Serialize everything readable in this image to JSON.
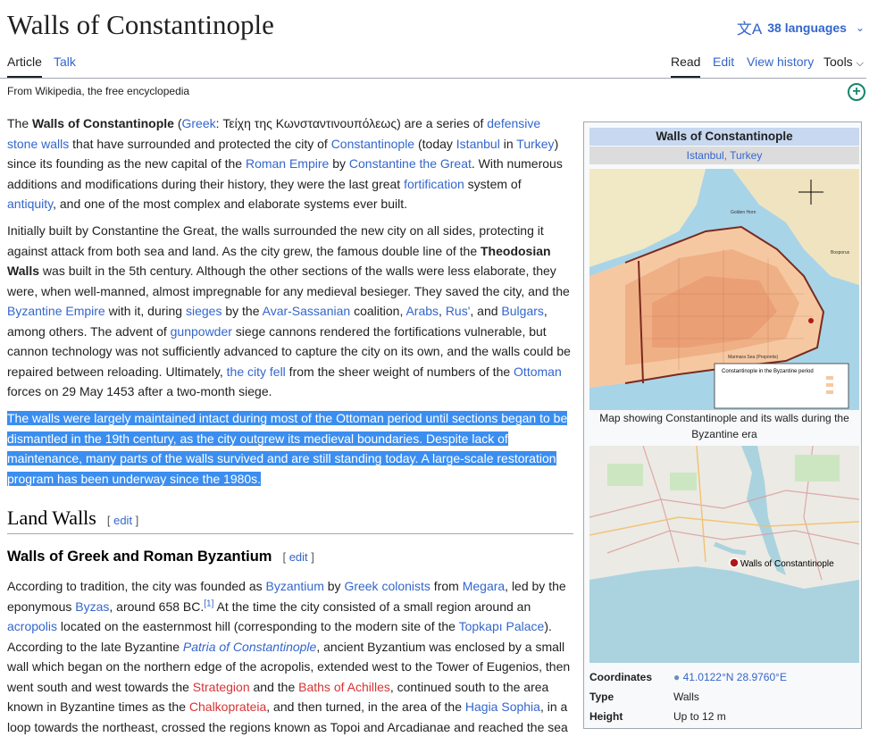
{
  "page": {
    "title": "Walls of Constantinople",
    "languages": "38 languages",
    "tabs": {
      "article": "Article",
      "talk": "Talk",
      "read": "Read",
      "edit": "Edit",
      "history": "View history",
      "tools": "Tools"
    },
    "subtitle": "From Wikipedia, the free encyclopedia"
  },
  "paragraphs": {
    "p1": {
      "t1": "The ",
      "b1": "Walls of Constantinople",
      "t2": " (",
      "l1": "Greek",
      "t3": ": Τείχη της Κωνσταντινουπόλεως) are a series of ",
      "l2": "defensive stone walls",
      "t4": " that have surrounded and protected the city of ",
      "l3": "Constantinople",
      "t5": " (today ",
      "l4": "Istanbul",
      "t6": " in ",
      "l5": "Turkey",
      "t7": ") since its founding as the new capital of the ",
      "l6": "Roman Empire",
      "t8": " by ",
      "l7": "Constantine the Great",
      "t9": ". With numerous additions and modifications during their history, they were the last great ",
      "l8": "fortification",
      "t10": " system of ",
      "l9": "antiquity",
      "t11": ", and one of the most complex and elaborate systems ever built."
    },
    "p2": {
      "t1": "Initially built by Constantine the Great, the walls surrounded the new city on all sides, protecting it against attack from both sea and land. As the city grew, the famous double line of the ",
      "b1": "Theodosian Walls",
      "t2": " was built in the 5th century. Although the other sections of the walls were less elaborate, they were, when well-manned, almost impregnable for any medieval besieger. They saved the city, and the ",
      "l1": "Byzantine Empire",
      "t3": " with it, during ",
      "l2": "sieges",
      "t4": " by the ",
      "l3": "Avar-Sassanian",
      "t5": " coalition, ",
      "l4": "Arabs",
      "t6": ", ",
      "l5": "Rus'",
      "t7": ", and ",
      "l6": "Bulgars",
      "t8": ", among others. The advent of ",
      "l7": "gunpowder",
      "t9": " siege cannons rendered the fortifications vulnerable, but cannon technology was not sufficiently advanced to capture the city on its own, and the walls could be repaired between reloading. Ultimately, ",
      "l8": "the city fell",
      "t10": " from the sheer weight of numbers of the ",
      "l9": "Ottoman",
      "t11": " forces on 29 May 1453 after a two-month siege."
    },
    "p3": "The walls were largely maintained intact during most of the Ottoman period until sections began to be dismantled in the 19th century, as the city outgrew its medieval boundaries. Despite lack of maintenance, many parts of the walls survived and are still standing today. A large-scale restoration program has been underway since the 1980s.",
    "p4": {
      "t1": "According to tradition, the city was founded as ",
      "l1": "Byzantium",
      "t2": " by ",
      "l2": "Greek colonists",
      "t3": " from ",
      "l3": "Megara",
      "t4": ", led by the eponymous ",
      "l4": "Byzas",
      "t5": ", around 658 BC.",
      "sup": "[1]",
      "t6": " At the time the city consisted of a small region around an ",
      "l5": "acropolis",
      "t7": " located on the easternmost hill (corresponding to the modern site of the ",
      "l6": "Topkapı Palace",
      "t8": "). According to the late Byzantine ",
      "l7": "Patria of Constantinople",
      "t9": ", ancient Byzantium was enclosed by a small wall which began on the northern edge of the acropolis, extended west to the Tower of Eugenios, then went south and west towards the ",
      "r1": "Strategion",
      "t10": " and the ",
      "r2": "Baths of Achilles",
      "t11": ", continued south to the area known in Byzantine times as the ",
      "r3": "Chalkoprateia",
      "t12": ", and then turned, in the area of the ",
      "l8": "Hagia Sophia",
      "t13": ", in a loop towards the northeast, crossed the regions known as Topoi and Arcadianae and reached the sea"
    }
  },
  "headings": {
    "h2": "Land Walls",
    "h3": "Walls of Greek and Roman Byzantium",
    "edit": "edit"
  },
  "infobox": {
    "title": "Walls of Constantinople",
    "sub_link1": "Istanbul",
    "sub_sep": ", ",
    "sub_link2": "Turkey",
    "map1_legend_title": "Constantinople in the Byzantine period",
    "map1_labels": {
      "golden_horn": "Golden Horn",
      "bosporus": "Bosporus",
      "marmara": "Marmara Sea (Propontis)"
    },
    "caption": "Map showing Constantinople and its walls during the Byzantine era",
    "map2_marker": "Walls of Constantinople",
    "rows": [
      {
        "key": "Coordinates",
        "value": "41.0122°N 28.9760°E"
      },
      {
        "key": "Type",
        "value": "Walls"
      },
      {
        "key": "Height",
        "value": "Up to 12 m"
      }
    ]
  },
  "colors": {
    "link": "#3366cc",
    "redlink": "#d73333",
    "selection": "#3b8ef0",
    "infobox_title": "#c7d8f0"
  }
}
